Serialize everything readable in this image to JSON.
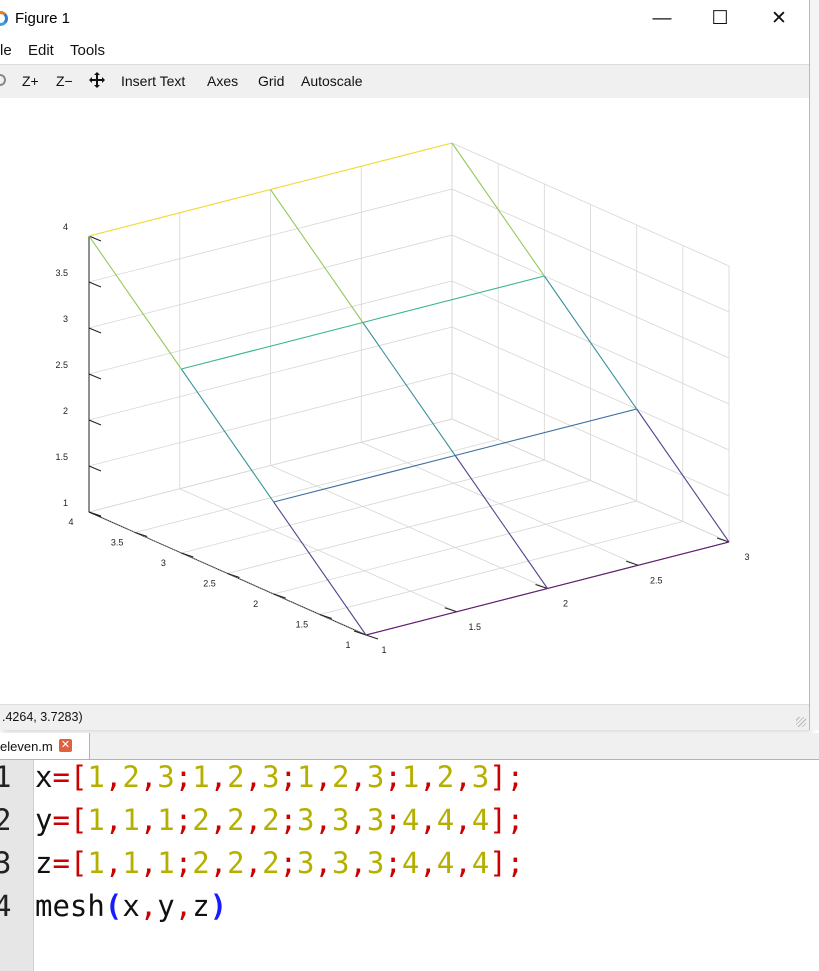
{
  "window": {
    "title": "Figure 1",
    "controls": {
      "minimize": "—",
      "maximize": "☐",
      "close": "✕"
    }
  },
  "menu": {
    "file": "le",
    "edit": "Edit",
    "tools": "Tools"
  },
  "toolbar": {
    "zoom_in": "Z+",
    "zoom_out": "Z−",
    "insert_text": "Insert Text",
    "axes": "Axes",
    "grid": "Grid",
    "autoscale": "Autoscale"
  },
  "status": {
    "coords": ".4264, 3.7283)"
  },
  "tab": {
    "label": "eleven.m",
    "close": "✕"
  },
  "colors": {
    "purple": "#6a1f7a",
    "blue": "#3d6fa0",
    "teal": "#3bb592",
    "yellow": "#f0dc2a"
  },
  "chart_data": {
    "type": "mesh",
    "x": [
      [
        1,
        2,
        3
      ],
      [
        1,
        2,
        3
      ],
      [
        1,
        2,
        3
      ],
      [
        1,
        2,
        3
      ]
    ],
    "y": [
      [
        1,
        1,
        1
      ],
      [
        2,
        2,
        2
      ],
      [
        3,
        3,
        3
      ],
      [
        4,
        4,
        4
      ]
    ],
    "z": [
      [
        1,
        1,
        1
      ],
      [
        2,
        2,
        2
      ],
      [
        3,
        3,
        3
      ],
      [
        4,
        4,
        4
      ]
    ],
    "x_ticks": [
      "1",
      "1.5",
      "2",
      "2.5",
      "3"
    ],
    "y_ticks": [
      "1",
      "1.5",
      "2",
      "2.5",
      "3",
      "3.5",
      "4"
    ],
    "z_ticks": [
      "1",
      "1.5",
      "2",
      "2.5",
      "3",
      "3.5",
      "4"
    ],
    "xlim": [
      1,
      3
    ],
    "ylim": [
      1,
      4
    ],
    "zlim": [
      1,
      4
    ],
    "grid": true
  },
  "editor": {
    "lines": [
      {
        "num": "1",
        "tokens": [
          {
            "t": "x",
            "c": "id"
          },
          {
            "t": "=",
            "c": "op"
          },
          {
            "t": "[",
            "c": "op"
          },
          {
            "t": "1",
            "c": "num"
          },
          {
            "t": ",",
            "c": "op"
          },
          {
            "t": "2",
            "c": "num"
          },
          {
            "t": ",",
            "c": "op"
          },
          {
            "t": "3",
            "c": "num"
          },
          {
            "t": ";",
            "c": "op"
          },
          {
            "t": "1",
            "c": "num"
          },
          {
            "t": ",",
            "c": "op"
          },
          {
            "t": "2",
            "c": "num"
          },
          {
            "t": ",",
            "c": "op"
          },
          {
            "t": "3",
            "c": "num"
          },
          {
            "t": ";",
            "c": "op"
          },
          {
            "t": "1",
            "c": "num"
          },
          {
            "t": ",",
            "c": "op"
          },
          {
            "t": "2",
            "c": "num"
          },
          {
            "t": ",",
            "c": "op"
          },
          {
            "t": "3",
            "c": "num"
          },
          {
            "t": ";",
            "c": "op"
          },
          {
            "t": "1",
            "c": "num"
          },
          {
            "t": ",",
            "c": "op"
          },
          {
            "t": "2",
            "c": "num"
          },
          {
            "t": ",",
            "c": "op"
          },
          {
            "t": "3",
            "c": "num"
          },
          {
            "t": "]",
            "c": "op"
          },
          {
            "t": ";",
            "c": "op"
          }
        ]
      },
      {
        "num": "2",
        "tokens": [
          {
            "t": "y",
            "c": "id"
          },
          {
            "t": "=",
            "c": "op"
          },
          {
            "t": "[",
            "c": "op"
          },
          {
            "t": "1",
            "c": "num"
          },
          {
            "t": ",",
            "c": "op"
          },
          {
            "t": "1",
            "c": "num"
          },
          {
            "t": ",",
            "c": "op"
          },
          {
            "t": "1",
            "c": "num"
          },
          {
            "t": ";",
            "c": "op"
          },
          {
            "t": "2",
            "c": "num"
          },
          {
            "t": ",",
            "c": "op"
          },
          {
            "t": "2",
            "c": "num"
          },
          {
            "t": ",",
            "c": "op"
          },
          {
            "t": "2",
            "c": "num"
          },
          {
            "t": ";",
            "c": "op"
          },
          {
            "t": "3",
            "c": "num"
          },
          {
            "t": ",",
            "c": "op"
          },
          {
            "t": "3",
            "c": "num"
          },
          {
            "t": ",",
            "c": "op"
          },
          {
            "t": "3",
            "c": "num"
          },
          {
            "t": ";",
            "c": "op"
          },
          {
            "t": "4",
            "c": "num"
          },
          {
            "t": ",",
            "c": "op"
          },
          {
            "t": "4",
            "c": "num"
          },
          {
            "t": ",",
            "c": "op"
          },
          {
            "t": "4",
            "c": "num"
          },
          {
            "t": "]",
            "c": "op"
          },
          {
            "t": ";",
            "c": "op"
          }
        ]
      },
      {
        "num": "3",
        "tokens": [
          {
            "t": "z",
            "c": "id"
          },
          {
            "t": "=",
            "c": "op"
          },
          {
            "t": "[",
            "c": "op"
          },
          {
            "t": "1",
            "c": "num"
          },
          {
            "t": ",",
            "c": "op"
          },
          {
            "t": "1",
            "c": "num"
          },
          {
            "t": ",",
            "c": "op"
          },
          {
            "t": "1",
            "c": "num"
          },
          {
            "t": ";",
            "c": "op"
          },
          {
            "t": "2",
            "c": "num"
          },
          {
            "t": ",",
            "c": "op"
          },
          {
            "t": "2",
            "c": "num"
          },
          {
            "t": ",",
            "c": "op"
          },
          {
            "t": "2",
            "c": "num"
          },
          {
            "t": ";",
            "c": "op"
          },
          {
            "t": "3",
            "c": "num"
          },
          {
            "t": ",",
            "c": "op"
          },
          {
            "t": "3",
            "c": "num"
          },
          {
            "t": ",",
            "c": "op"
          },
          {
            "t": "3",
            "c": "num"
          },
          {
            "t": ";",
            "c": "op"
          },
          {
            "t": "4",
            "c": "num"
          },
          {
            "t": ",",
            "c": "op"
          },
          {
            "t": "4",
            "c": "num"
          },
          {
            "t": ",",
            "c": "op"
          },
          {
            "t": "4",
            "c": "num"
          },
          {
            "t": "]",
            "c": "op"
          },
          {
            "t": ";",
            "c": "op"
          }
        ]
      },
      {
        "num": "4",
        "tokens": [
          {
            "t": "mesh",
            "c": "id"
          },
          {
            "t": "(",
            "c": "par"
          },
          {
            "t": "x",
            "c": "id"
          },
          {
            "t": ",",
            "c": "op"
          },
          {
            "t": "y",
            "c": "id"
          },
          {
            "t": ",",
            "c": "op"
          },
          {
            "t": "z",
            "c": "id"
          },
          {
            "t": ")",
            "c": "par"
          }
        ]
      }
    ]
  }
}
